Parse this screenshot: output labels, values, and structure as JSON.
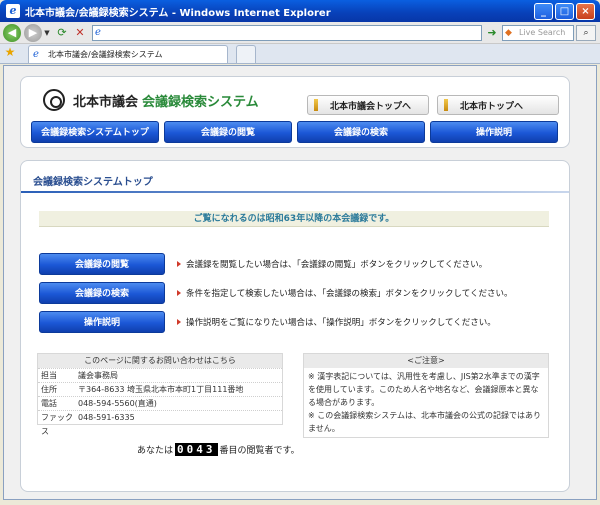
{
  "window": {
    "title": "北本市議会/会議録検索システム - Windows Internet Explorer",
    "minimize": "_",
    "maximize": "□",
    "close": "×"
  },
  "browser": {
    "search_placeholder": "Live Search",
    "tab_title": "北本市議会/会議録検索システム"
  },
  "header": {
    "site_name": "北本市議会",
    "system_name": "会議録検索システム",
    "top_links": [
      "北本市議会トップへ",
      "北本市トップへ"
    ],
    "menu": [
      "会議録検索システムトップ",
      "会議録の閲覧",
      "会議録の検索",
      "操作説明"
    ]
  },
  "main": {
    "section_title": "会議録検索システムトップ",
    "notice": "ご覧になれるのは昭和63年以降の本会議録です。",
    "actions": [
      {
        "label": "会議録の閲覧",
        "desc": "会議録を閲覧したい場合は、「会議録の閲覧」ボタンをクリックしてください。"
      },
      {
        "label": "会議録の検索",
        "desc": "条件を指定して検索したい場合は、「会議録の検索」ボタンをクリックしてください。"
      },
      {
        "label": "操作説明",
        "desc": "操作説明をご覧になりたい場合は、「操作説明」ボタンをクリックしてください。"
      }
    ],
    "contact": {
      "heading": "このページに関するお問い合わせはこちら",
      "rows": [
        {
          "k": "担当",
          "v": "議会事務局"
        },
        {
          "k": "住所",
          "v": "〒364-8633 埼玉県北本市本町1丁目111番地"
        },
        {
          "k": "電話",
          "v": "048-594-5560(直通)"
        },
        {
          "k": "ファックス",
          "v": "048-591-6335"
        }
      ]
    },
    "caution": {
      "heading": "<ご注意>",
      "lines": [
        "※ 漢字表記については、汎用性を考慮し、JIS第2水準までの漢字を使用しています。このため人名や地名など、会議録原本と異なる場合があります。",
        "※ この会議録検索システムは、北本市議会の公式の記録ではありません。"
      ]
    },
    "counter": {
      "prefix": "あなたは",
      "digits": "0043",
      "suffix": "番目の閲覧者です。"
    }
  }
}
